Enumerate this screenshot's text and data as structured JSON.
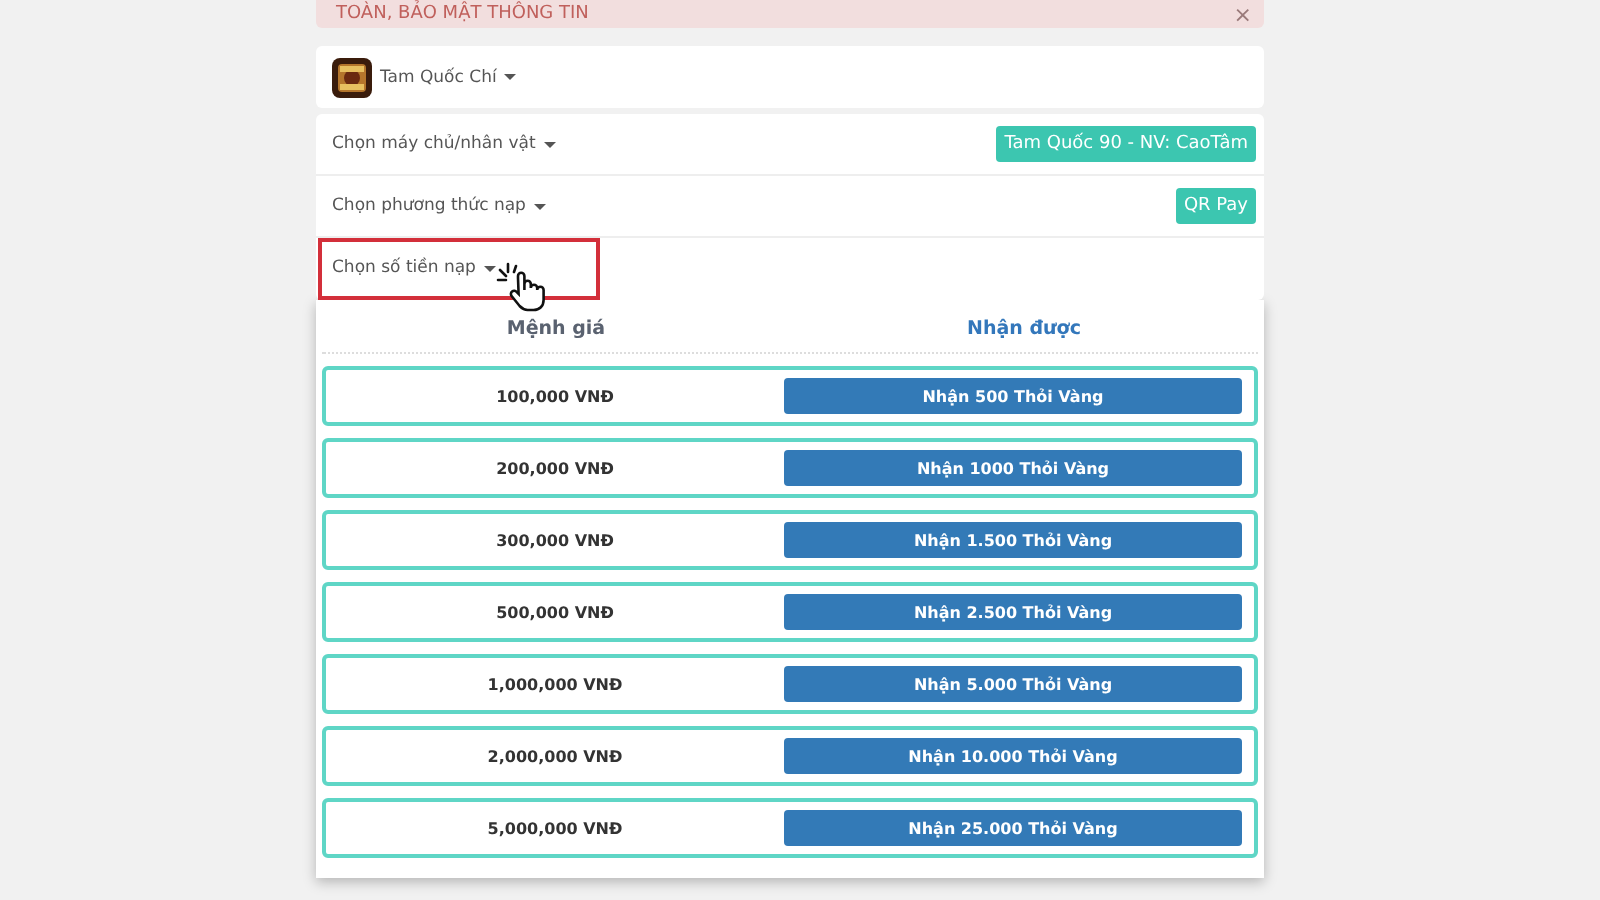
{
  "alert": {
    "text": "TOÀN, BẢO MẬT THÔNG TIN",
    "close": "×"
  },
  "game": {
    "name": "Tam Quốc Chí"
  },
  "options": [
    {
      "label": "Chọn máy chủ/nhân vật",
      "value": "Tam Quốc 90 - NV: CaoTâm",
      "highlighted": false
    },
    {
      "label": "Chọn phương thức nạp",
      "value": "QR Pay",
      "highlighted": false
    },
    {
      "label": "Chọn số tiền nạp",
      "highlighted": true
    }
  ],
  "table": {
    "columns": [
      "Mệnh giá",
      "Nhận được"
    ],
    "rows": [
      {
        "amount": "100,000 VNĐ",
        "reward": "Nhận 500 Thỏi Vàng"
      },
      {
        "amount": "200,000 VNĐ",
        "reward": "Nhận 1000 Thỏi Vàng"
      },
      {
        "amount": "300,000 VNĐ",
        "reward": "Nhận 1.500 Thỏi Vàng"
      },
      {
        "amount": "500,000 VNĐ",
        "reward": "Nhận 2.500 Thỏi Vàng"
      },
      {
        "amount": "1,000,000 VNĐ",
        "reward": "Nhận 5.000 Thỏi Vàng"
      },
      {
        "amount": "2,000,000 VNĐ",
        "reward": "Nhận 10.000 Thỏi Vàng"
      },
      {
        "amount": "5,000,000 VNĐ",
        "reward": "Nhận 25.000 Thỏi Vàng"
      }
    ]
  }
}
